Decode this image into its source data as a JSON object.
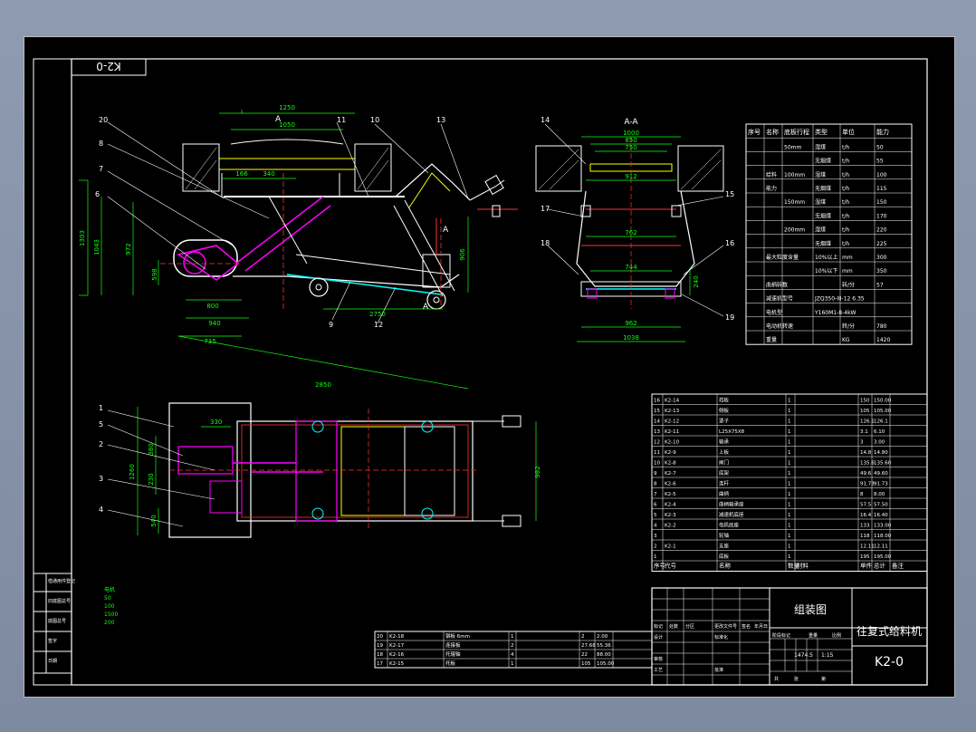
{
  "drawing": {
    "number": "K2-0",
    "title": "往复式给料机",
    "view_title": "组装图",
    "scale_text": "1474.5",
    "scale_ratio": "1:15",
    "side_note": [
      "电机",
      "50",
      "100",
      "1500",
      "200"
    ]
  },
  "views": {
    "main": {
      "balloons": [
        "20",
        "8",
        "7",
        "6",
        "11",
        "10",
        "13",
        "9",
        "12"
      ],
      "dims": {
        "top_width": "1250",
        "inner_width": "1050",
        "d166": "166",
        "d340": "340",
        "d1303": "1303",
        "d1043": "1043",
        "d972": "972",
        "d598": "598",
        "d800": "800",
        "d940": "940",
        "d735": "735",
        "d2750": "2750",
        "d2850": "2850",
        "d906": "906",
        "section": "A"
      }
    },
    "section": {
      "title": "A-A",
      "balloons": [
        "14",
        "15",
        "17",
        "18",
        "16",
        "19"
      ],
      "dims": {
        "d1000": "1000",
        "d850": "850",
        "d750": "750",
        "d912": "912",
        "d762": "762",
        "d744": "744",
        "d962": "962",
        "d1038": "1038",
        "d240": "240"
      }
    },
    "plan": {
      "balloons": [
        "1",
        "5",
        "2",
        "3",
        "4"
      ],
      "dims": {
        "d330": "330",
        "d380": "380",
        "d230": "230",
        "d1260": "1260",
        "d540": "540",
        "d982": "982"
      }
    }
  },
  "spec_table": {
    "headers": [
      "序号",
      "名称",
      "底板行程",
      "类型",
      "单位",
      "能力"
    ],
    "rows": [
      [
        "",
        "",
        "50mm",
        "湿煤",
        "t/h",
        "50"
      ],
      [
        "",
        "",
        "",
        "无烟煤",
        "t/h",
        "55"
      ],
      [
        "",
        "给料",
        "100mm",
        "湿煤",
        "t/h",
        "100"
      ],
      [
        "",
        "能力",
        "",
        "无烟煤",
        "t/h",
        "115"
      ],
      [
        "",
        "",
        "150mm",
        "湿煤",
        "t/h",
        "150"
      ],
      [
        "",
        "",
        "",
        "无烟煤",
        "t/h",
        "170"
      ],
      [
        "",
        "",
        "200mm",
        "湿煤",
        "t/h",
        "220"
      ],
      [
        "",
        "",
        "",
        "无烟煤",
        "t/h",
        "225"
      ],
      [
        "",
        "最大粒度含量",
        "",
        "10%以上",
        "mm",
        "300"
      ],
      [
        "",
        "",
        "",
        "10%以下",
        "mm",
        "350"
      ],
      [
        "",
        "曲柄转数",
        "",
        "",
        "转/分",
        "57"
      ],
      [
        "",
        "减速机型号",
        "",
        "JZQ350-III-12 6.35",
        "",
        ""
      ],
      [
        "",
        "电机型",
        "",
        "Y160M1-8-4kW",
        "",
        ""
      ],
      [
        "",
        "电动机转速",
        "",
        "",
        "转/分",
        "780"
      ],
      [
        "",
        "重量",
        "",
        "",
        "KG",
        "1420"
      ]
    ]
  },
  "parts_list": {
    "rows": [
      [
        "16",
        "K2-14",
        "挡板",
        "1",
        "",
        "150",
        "150.00"
      ],
      [
        "15",
        "K2-13",
        "侧板",
        "1",
        "",
        "105",
        "105.00"
      ],
      [
        "14",
        "K2-12",
        "罩子",
        "1",
        "",
        "126.1",
        "126.1"
      ],
      [
        "13",
        "K2-11",
        "L25X75X8",
        "1",
        "",
        "3.1",
        "6.10"
      ],
      [
        "12",
        "K2-10",
        "轴承",
        "1",
        "",
        "3",
        "3.00"
      ],
      [
        "11",
        "K2-9",
        "上板",
        "1",
        "",
        "14.8",
        "14.80"
      ],
      [
        "10",
        "K2-8",
        "闸门",
        "1",
        "",
        "135.6",
        "135.60"
      ],
      [
        "9",
        "K2-7",
        "底架",
        "1",
        "",
        "49.6",
        "49.60"
      ],
      [
        "8",
        "K2-6",
        "连杆",
        "1",
        "",
        "91.73",
        "91.73"
      ],
      [
        "7",
        "K2-5",
        "曲柄",
        "1",
        "",
        "8",
        "8.00"
      ],
      [
        "6",
        "K2-4",
        "曲柄轴承座",
        "1",
        "",
        "57.5",
        "57.50"
      ],
      [
        "5",
        "K2-3",
        "减速机底座",
        "1",
        "",
        "16.4",
        "16.40"
      ],
      [
        "4",
        "K2-2",
        "电机底座",
        "1",
        "",
        "133",
        "133.00"
      ],
      [
        "3",
        "",
        "轮轴",
        "1",
        "",
        "118",
        "118.00"
      ],
      [
        "2",
        "K2-1",
        "支座",
        "1",
        "",
        "12.11",
        "12.11"
      ],
      [
        "1",
        "",
        "底板",
        "1",
        "",
        "195",
        "195.00"
      ]
    ],
    "header": [
      "序号",
      "代号",
      "名称",
      "数量",
      "材料",
      "单件",
      "总计",
      "备注"
    ],
    "mass_header": "重量"
  },
  "bottom_list": {
    "rows": [
      [
        "20",
        "K2-18",
        "钢板 6mm",
        "1",
        "",
        "2",
        "2.00"
      ],
      [
        "19",
        "K2-17",
        "连接板",
        "2",
        "",
        "27.68",
        "55.36"
      ],
      [
        "18",
        "K2-16",
        "托辊轴",
        "4",
        "",
        "22",
        "88.00"
      ],
      [
        "17",
        "K2-15",
        "托板",
        "1",
        "",
        "105",
        "105.00"
      ]
    ]
  },
  "title_block": {
    "labels": [
      "标记",
      "处数",
      "分区",
      "更改文件号",
      "签名",
      "年月日",
      "设计",
      "审核",
      "工艺",
      "批准",
      "标准化",
      "阶段标记",
      "重量",
      "比例",
      "共",
      "张",
      "第"
    ]
  },
  "revision_block": {
    "labels": [
      "借通用件登记",
      "旧底图总号",
      "底图总号",
      "签字",
      "日期"
    ]
  }
}
